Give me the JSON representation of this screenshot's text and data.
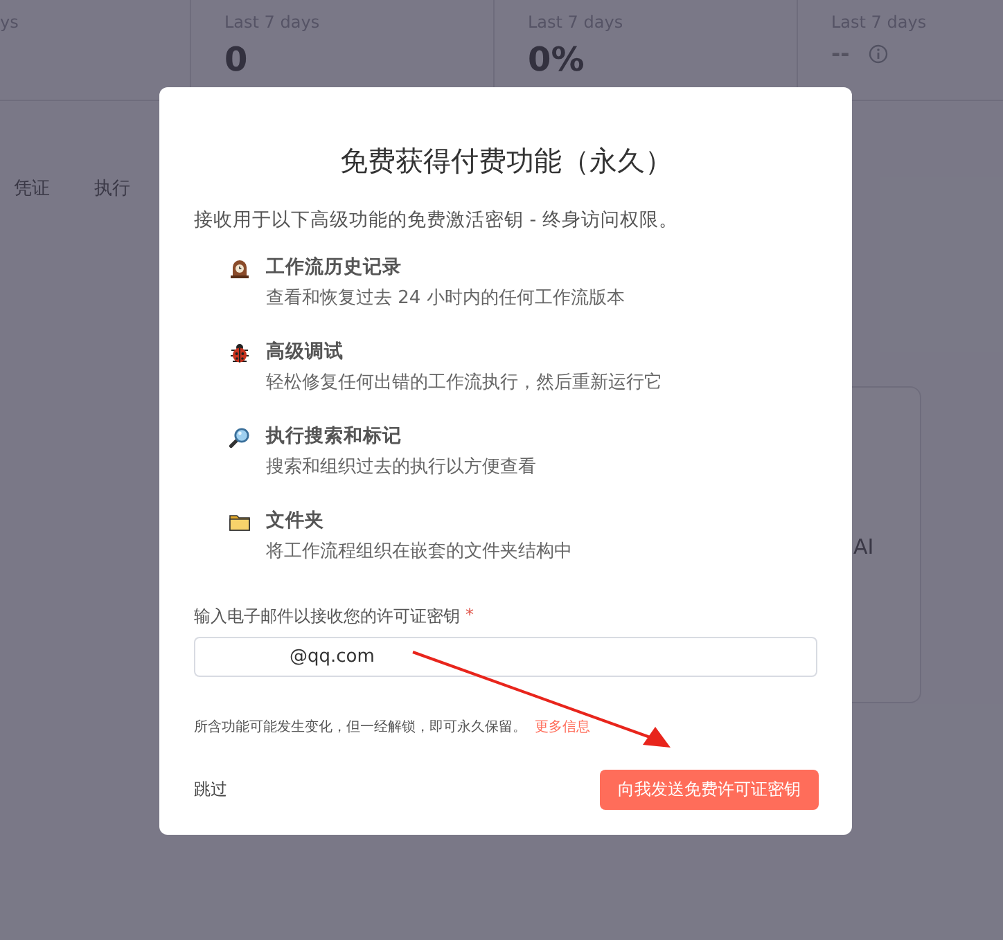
{
  "background": {
    "stats": [
      {
        "subtitle": "ys"
      },
      {
        "subtitle": "Last 7 days",
        "value": "0"
      },
      {
        "subtitle": "Last 7 days",
        "value": "0%"
      },
      {
        "subtitle": "Last 7 days",
        "value": "--",
        "info": true
      }
    ],
    "tabs": [
      {
        "label": "凭证"
      },
      {
        "label": "执行"
      }
    ],
    "card_text": "AI"
  },
  "dialog": {
    "title": "免费获得付费功能（永久）",
    "intro": "接收用于以下高级功能的免费激活密钥 - 终身访问权限。",
    "features": [
      {
        "kind": "clock",
        "title": "工作流历史记录",
        "description": "查看和恢复过去 24 小时内的任何工作流版本"
      },
      {
        "kind": "bug",
        "title": "高级调试",
        "description": "轻松修复任何出错的工作流执行，然后重新运行它"
      },
      {
        "kind": "magnifier",
        "title": "执行搜索和标记",
        "description": "搜索和组织过去的执行以方便查看"
      },
      {
        "kind": "folder",
        "title": "文件夹",
        "description": "将工作流程组织在嵌套的文件夹结构中"
      }
    ],
    "email": {
      "label": "输入电子邮件以接收您的许可证密钥",
      "required_mark": "*",
      "value": "@qq.com"
    },
    "note": "所含功能可能发生变化，但一经解锁，即可永久保留。",
    "note_link": "更多信息",
    "skip": "跳过",
    "submit": "向我发送免费许可证密钥"
  }
}
